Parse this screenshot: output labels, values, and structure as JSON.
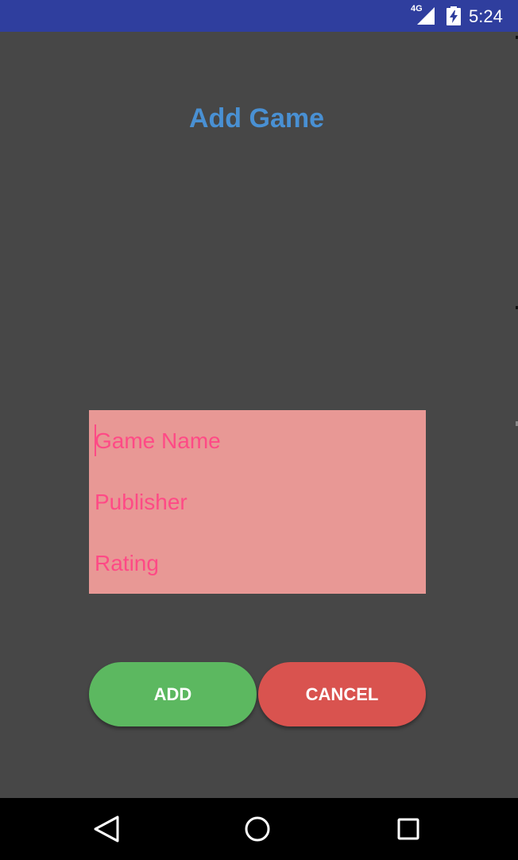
{
  "status_bar": {
    "network_label": "4G",
    "time": "5:24",
    "icons": [
      "signal-icon",
      "battery-charging-icon"
    ],
    "color": "#2f3e9e"
  },
  "screen": {
    "title": "Add Game",
    "title_color": "#4990d3",
    "background": "#474747"
  },
  "form": {
    "background": "#e89895",
    "text_color": "#ff4a86",
    "fields": [
      {
        "placeholder": "Game Name",
        "value": ""
      },
      {
        "placeholder": "Publisher",
        "value": ""
      },
      {
        "placeholder": "Rating",
        "value": ""
      }
    ]
  },
  "buttons": {
    "add_label": "ADD",
    "add_color": "#5cb860",
    "cancel_label": "CANCEL",
    "cancel_color": "#d9534f"
  },
  "nav_bar": {
    "icons": [
      "back-icon",
      "home-icon",
      "recents-icon"
    ]
  }
}
